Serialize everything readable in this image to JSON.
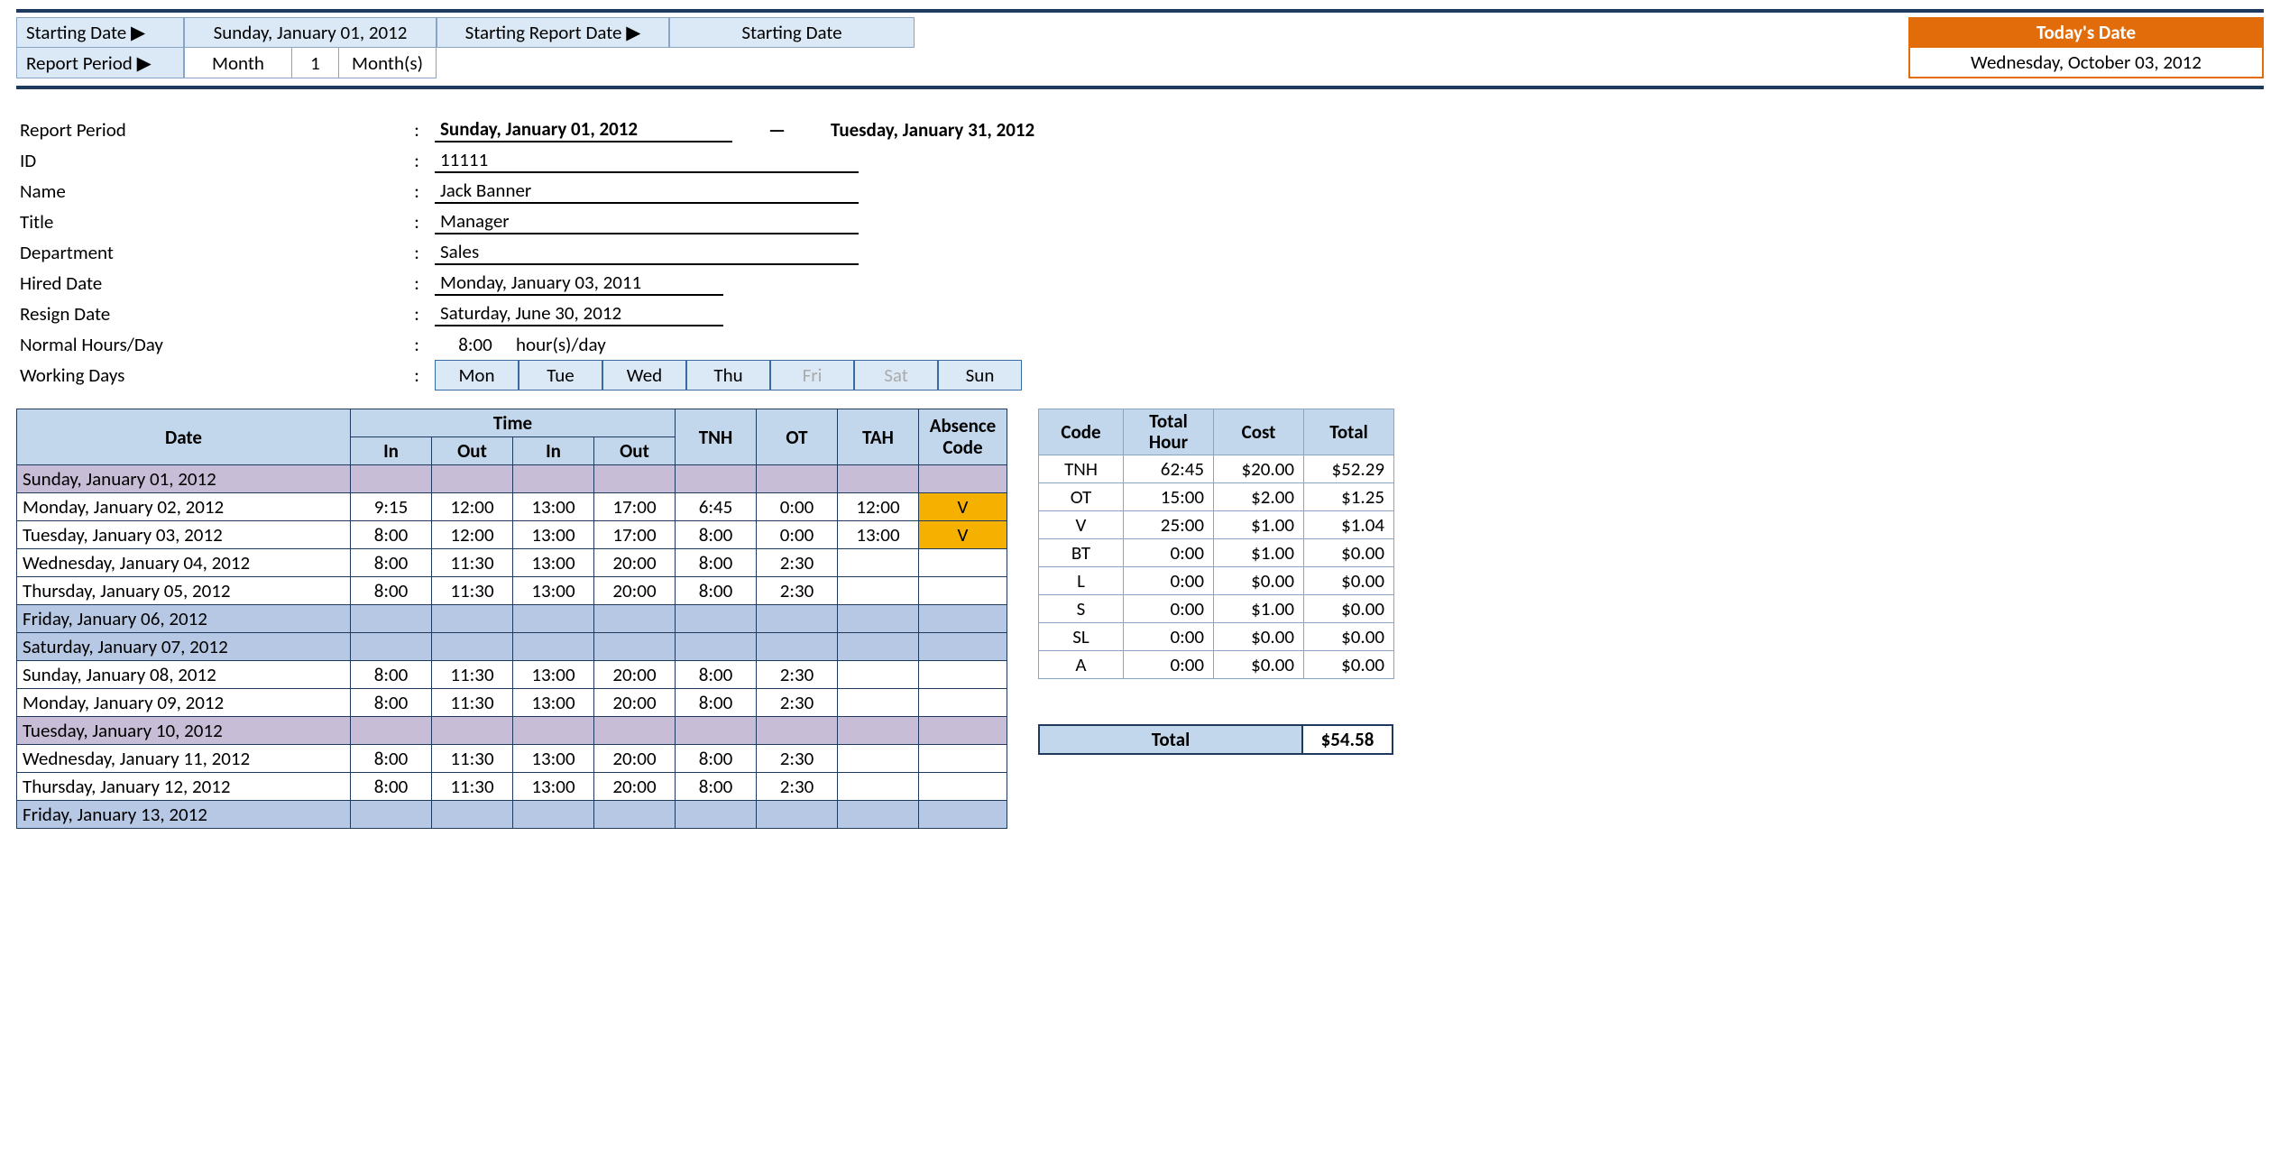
{
  "controls": {
    "starting_date_label": "Starting Date ▶",
    "starting_date_value": "Sunday, January 01, 2012",
    "report_period_label": "Report Period ▶",
    "report_period_unit": "Month",
    "report_period_count": "1",
    "report_period_suffix": "Month(s)",
    "starting_report_date_label": "Starting Report Date ▶",
    "starting_report_date_value": "Starting Date"
  },
  "today_box": {
    "header": "Today's Date",
    "value": "Wednesday, October 03, 2012"
  },
  "info": {
    "report_period_label": "Report Period",
    "period_start": "Sunday, January 01, 2012",
    "period_end": "Tuesday, January 31, 2012",
    "id_label": "ID",
    "id_value": "11111",
    "name_label": "Name",
    "name_value": "Jack Banner",
    "title_label": "Title",
    "title_value": "Manager",
    "department_label": "Department",
    "department_value": "Sales",
    "hired_label": "Hired Date",
    "hired_value": "Monday, January 03, 2011",
    "resign_label": "Resign Date",
    "resign_value": "Saturday, June 30, 2012",
    "normal_hours_label": "Normal Hours/Day",
    "normal_hours_value": "8:00",
    "normal_hours_suffix": "hour(s)/day",
    "working_days_label": "Working Days",
    "days": [
      "Mon",
      "Tue",
      "Wed",
      "Thu",
      "Fri",
      "Sat",
      "Sun"
    ],
    "days_active": [
      true,
      true,
      true,
      true,
      false,
      false,
      true
    ]
  },
  "table_headers": {
    "date": "Date",
    "time": "Time",
    "in": "In",
    "out": "Out",
    "tnh": "TNH",
    "ot": "OT",
    "tah": "TAH",
    "absence": "Absence Code"
  },
  "rows": [
    {
      "date": "Sunday, January 01, 2012",
      "style": "purple"
    },
    {
      "date": "Monday, January 02, 2012",
      "in1": "9:15",
      "out1": "12:00",
      "in2": "13:00",
      "out2": "17:00",
      "tnh": "6:45",
      "ot": "0:00",
      "tah": "12:00",
      "abs": "V"
    },
    {
      "date": "Tuesday, January 03, 2012",
      "in1": "8:00",
      "out1": "12:00",
      "in2": "13:00",
      "out2": "17:00",
      "tnh": "8:00",
      "ot": "0:00",
      "tah": "13:00",
      "abs": "V"
    },
    {
      "date": "Wednesday, January 04, 2012",
      "in1": "8:00",
      "out1": "11:30",
      "in2": "13:00",
      "out2": "20:00",
      "tnh": "8:00",
      "ot": "2:30"
    },
    {
      "date": "Thursday, January 05, 2012",
      "in1": "8:00",
      "out1": "11:30",
      "in2": "13:00",
      "out2": "20:00",
      "tnh": "8:00",
      "ot": "2:30"
    },
    {
      "date": "Friday, January 06, 2012",
      "style": "blue"
    },
    {
      "date": "Saturday, January 07, 2012",
      "style": "blue"
    },
    {
      "date": "Sunday, January 08, 2012",
      "in1": "8:00",
      "out1": "11:30",
      "in2": "13:00",
      "out2": "20:00",
      "tnh": "8:00",
      "ot": "2:30"
    },
    {
      "date": "Monday, January 09, 2012",
      "in1": "8:00",
      "out1": "11:30",
      "in2": "13:00",
      "out2": "20:00",
      "tnh": "8:00",
      "ot": "2:30"
    },
    {
      "date": "Tuesday, January 10, 2012",
      "style": "purple"
    },
    {
      "date": "Wednesday, January 11, 2012",
      "in1": "8:00",
      "out1": "11:30",
      "in2": "13:00",
      "out2": "20:00",
      "tnh": "8:00",
      "ot": "2:30"
    },
    {
      "date": "Thursday, January 12, 2012",
      "in1": "8:00",
      "out1": "11:30",
      "in2": "13:00",
      "out2": "20:00",
      "tnh": "8:00",
      "ot": "2:30"
    },
    {
      "date": "Friday, January 13, 2012",
      "style": "blue"
    }
  ],
  "summary_headers": {
    "code": "Code",
    "total_hour": "Total Hour",
    "cost": "Cost",
    "total": "Total"
  },
  "summary_rows": [
    {
      "code": "TNH",
      "hour": "62:45",
      "cost": "$20.00",
      "total": "$52.29"
    },
    {
      "code": "OT",
      "hour": "15:00",
      "cost": "$2.00",
      "total": "$1.25"
    },
    {
      "code": "V",
      "hour": "25:00",
      "cost": "$1.00",
      "total": "$1.04"
    },
    {
      "code": "BT",
      "hour": "0:00",
      "cost": "$1.00",
      "total": "$0.00"
    },
    {
      "code": "L",
      "hour": "0:00",
      "cost": "$0.00",
      "total": "$0.00"
    },
    {
      "code": "S",
      "hour": "0:00",
      "cost": "$1.00",
      "total": "$0.00"
    },
    {
      "code": "SL",
      "hour": "0:00",
      "cost": "$0.00",
      "total": "$0.00"
    },
    {
      "code": "A",
      "hour": "0:00",
      "cost": "$0.00",
      "total": "$0.00"
    }
  ],
  "grand_total": {
    "label": "Total",
    "value": "$54.58"
  }
}
